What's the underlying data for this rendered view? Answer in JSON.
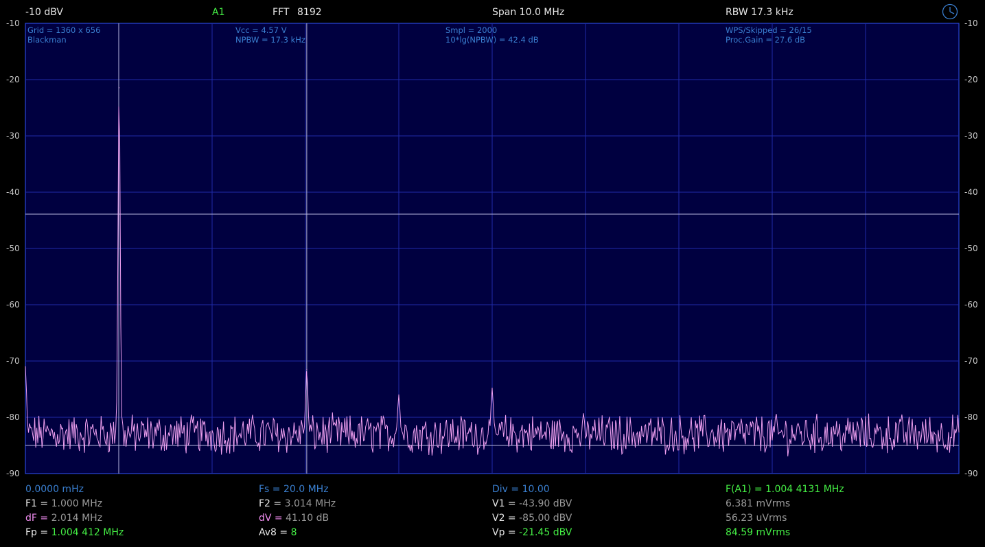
{
  "header": {
    "ref_level": "-10 dBV",
    "channel": "A1",
    "fft_label": "FFT",
    "fft_size": "8192",
    "span": "Span 10.0 MHz",
    "rbw": "RBW 17.3 kHz",
    "clock_icon": "clock-icon"
  },
  "info": {
    "grid": "Grid = 1360 x 656",
    "window": "Blackman",
    "vcc": "Vcc = 4.57 V",
    "npbw": "NPBW = 17.3 kHz",
    "smpl": "Smpl = 2000",
    "npbw_db": "10*lg(NPBW) = 42.4 dB",
    "wps": "WPS/Skipped  = 26/15",
    "proc_gain": "Proc.Gain = 27.6 dB"
  },
  "measurements": {
    "col1": [
      {
        "label": "0.0000 mHz",
        "value": ""
      },
      {
        "label": "F1 = ",
        "value": "1.000 MHz"
      },
      {
        "label": "dF = ",
        "value": "2.014 MHz"
      },
      {
        "label": "Fp = ",
        "value": "1.004 412 MHz"
      }
    ],
    "col2": [
      {
        "label": "Fs = 20.0 MHz",
        "value": ""
      },
      {
        "label": "F2 = ",
        "value": "3.014 MHz"
      },
      {
        "label": "dV = ",
        "value": "41.10 dB"
      },
      {
        "label": "Av8 = ",
        "value": "8"
      }
    ],
    "col3": [
      {
        "label": "Div = 10.00",
        "value": ""
      },
      {
        "label": "V1 = ",
        "value": "-43.90 dBV"
      },
      {
        "label": "V2 = ",
        "value": "-85.00 dBV"
      },
      {
        "label": "Vp = ",
        "value": "-21.45 dBV"
      }
    ],
    "col4": [
      {
        "label": "F(A1) = 1.004 4131 MHz",
        "value": ""
      },
      {
        "label": "",
        "value": "6.381 mVrms"
      },
      {
        "label": "",
        "value": "56.23 uVrms"
      },
      {
        "label": "",
        "value": "84.59 mVrms"
      }
    ]
  },
  "colors": {
    "plot_bg": "#000040",
    "grid": "#1f2aa8",
    "border": "#2a47d8",
    "trace": "#f0a0f0",
    "cursor": "#b8b8e0",
    "green": "#45f045",
    "blue": "#3a7fd0",
    "pink": "#f28ef2"
  },
  "chart_data": {
    "type": "line",
    "xlim": [
      0,
      10
    ],
    "ylim": [
      -90,
      -10
    ],
    "ytick_labels": [
      "-10",
      "-20",
      "-30",
      "-40",
      "-50",
      "-60",
      "-70",
      "-80",
      "-90"
    ],
    "grid": true,
    "noise_floor": -83,
    "peaks": [
      {
        "x": 1.004,
        "y": -21.45
      },
      {
        "x": 3.014,
        "y": -71.5
      },
      {
        "x": 4.0,
        "y": -76.0
      },
      {
        "x": 5.0,
        "y": -74.8
      },
      {
        "x": 0.0,
        "y": -71.0
      }
    ],
    "cursors": {
      "f1": 1.0,
      "f2": 3.014,
      "v1": -43.9,
      "v2": -85.0
    }
  }
}
